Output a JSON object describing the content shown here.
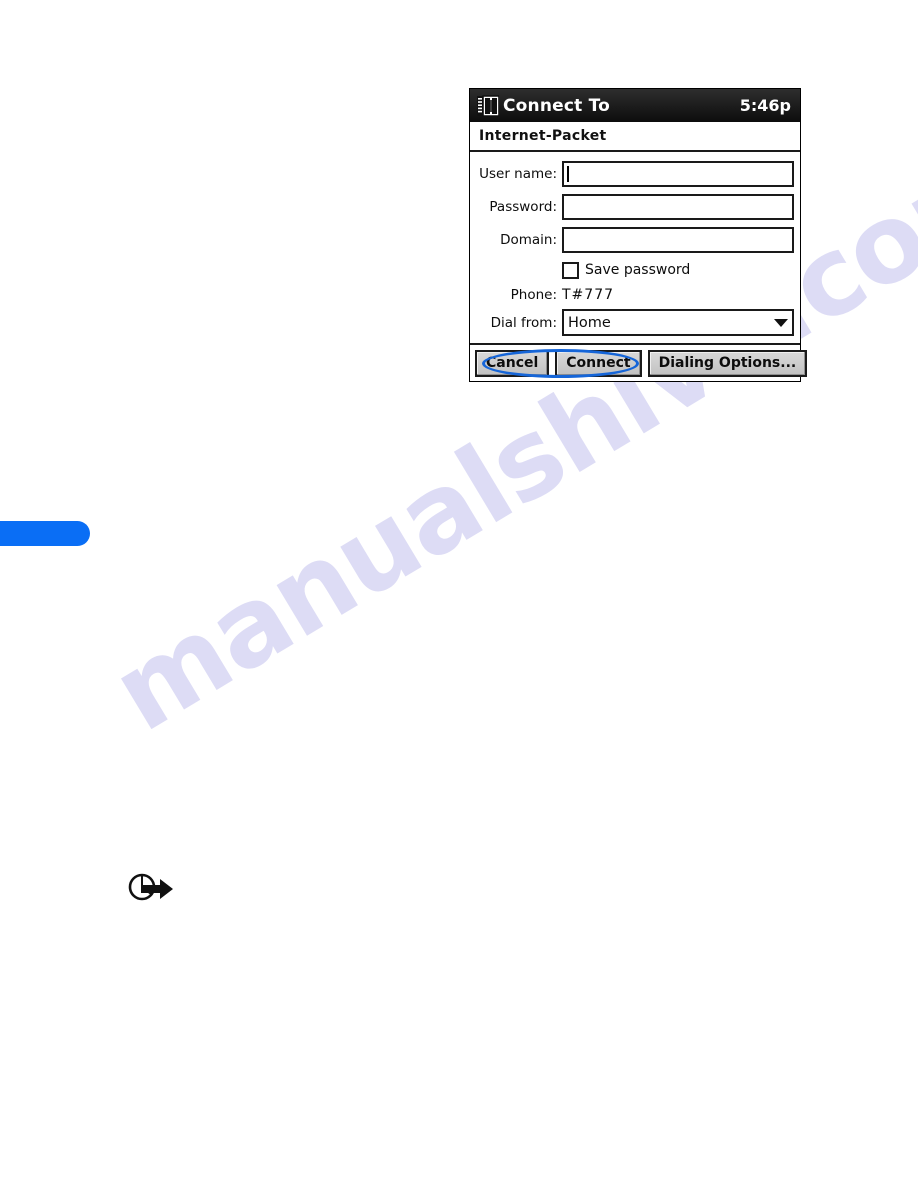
{
  "page": {
    "watermark_text": "manualshive.com",
    "tab_color": "#0a6ef5",
    "annotation_color": "#1565d8",
    "note_icon": "circle-arrow-note-icon"
  },
  "dialog": {
    "titlebar": {
      "icon": "book-binder-icon",
      "title": "Connect To",
      "time": "5:46p"
    },
    "connection": {
      "name": "Internet-Packet"
    },
    "fields": [
      {
        "label": "User name:",
        "value": "",
        "placeholder": "",
        "focused": true
      },
      {
        "label": "Password:",
        "value": "",
        "placeholder": "",
        "focused": false
      },
      {
        "label": "Domain:",
        "value": "",
        "placeholder": "",
        "focused": false
      }
    ],
    "save_password": {
      "label": "Save password",
      "checked": false
    },
    "phone": {
      "label": "Phone:",
      "value": "T#777"
    },
    "dial_from": {
      "label": "Dial from:",
      "selected": "Home",
      "arrow_icon": "chevron-down-icon"
    },
    "buttons": {
      "cancel": "Cancel",
      "connect": "Connect",
      "dialing_options": "Dialing Options..."
    }
  }
}
